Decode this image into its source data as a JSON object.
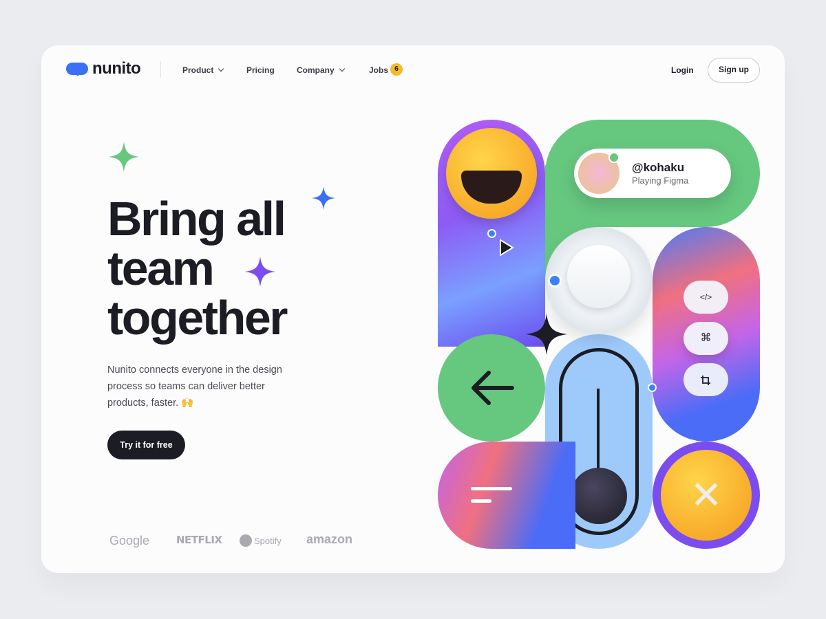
{
  "brand": {
    "name": "nunito"
  },
  "nav": {
    "items": [
      {
        "label": "Product",
        "has_dropdown": true
      },
      {
        "label": "Pricing"
      },
      {
        "label": "Company",
        "has_dropdown": true
      },
      {
        "label": "Jobs",
        "badge": "6"
      }
    ],
    "login": "Login",
    "signup": "Sign up"
  },
  "hero": {
    "headline_lines": [
      "Bring all",
      "team",
      "together"
    ],
    "subtitle": "Nunito connects everyone in the design process so teams can deliver better products, faster. 🙌",
    "cta": "Try it for free"
  },
  "logos": [
    "Google",
    "NETFLIX",
    "Spotify",
    "amazon"
  ],
  "illustration": {
    "user_handle": "@kohaku",
    "user_status": "Playing Figma",
    "tool_buttons": [
      "</>",
      "⌘",
      "crop-icon"
    ]
  },
  "colors": {
    "accent": "#3b6ff5",
    "green": "#66c77f",
    "dark": "#1c1c24",
    "badge": "#f7b928",
    "purple": "#7b4cf0"
  }
}
